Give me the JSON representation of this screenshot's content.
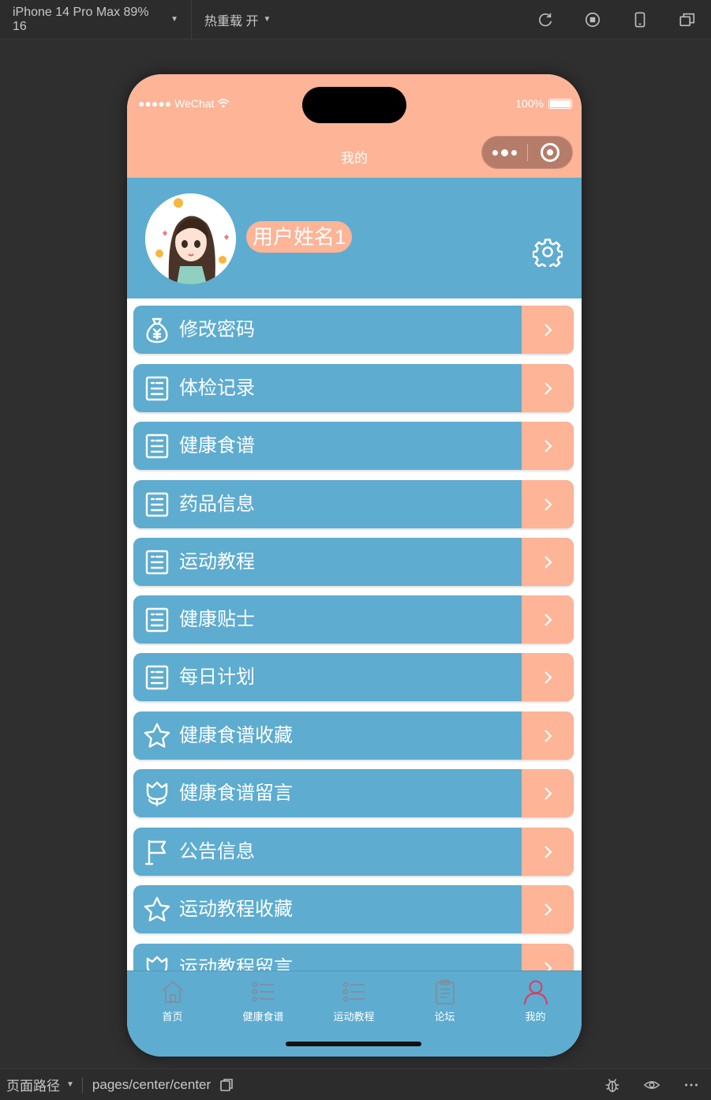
{
  "toolbar": {
    "device": "iPhone 14 Pro Max 89% 16",
    "hot_reload": "热重载 开",
    "icons": [
      "refresh-icon",
      "stop-icon",
      "phone-icon",
      "window-icon"
    ]
  },
  "statusbar": {
    "carrier": "●●●●● WeChat",
    "battery": "100%"
  },
  "nav": {
    "title": "我的"
  },
  "profile": {
    "username": "用户姓名1",
    "icons": [
      "avatar",
      "gear-icon"
    ]
  },
  "menu": [
    {
      "label": "修改密码",
      "icon": "money-bag-icon"
    },
    {
      "label": "体检记录",
      "icon": "document-icon"
    },
    {
      "label": "健康食谱",
      "icon": "document-icon"
    },
    {
      "label": "药品信息",
      "icon": "document-icon"
    },
    {
      "label": "运动教程",
      "icon": "document-icon"
    },
    {
      "label": "健康贴士",
      "icon": "document-icon"
    },
    {
      "label": "每日计划",
      "icon": "document-icon"
    },
    {
      "label": "健康食谱收藏",
      "icon": "star-icon"
    },
    {
      "label": "健康食谱留言",
      "icon": "tulip-icon"
    },
    {
      "label": "公告信息",
      "icon": "flag-icon"
    },
    {
      "label": "运动教程收藏",
      "icon": "star-icon"
    },
    {
      "label": "运动教程留言",
      "icon": "tulip-icon"
    }
  ],
  "tabbar": [
    {
      "label": "首页",
      "icon": "home-icon",
      "active": false
    },
    {
      "label": "健康食谱",
      "icon": "list-icon",
      "active": false
    },
    {
      "label": "运动教程",
      "icon": "list-icon",
      "active": false
    },
    {
      "label": "论坛",
      "icon": "clipboard-icon",
      "active": false
    },
    {
      "label": "我的",
      "icon": "user-icon",
      "active": true
    }
  ],
  "bottombar": {
    "path_label": "页面路径",
    "path": "pages/center/center",
    "icons": [
      "copy-icon",
      "bug-icon",
      "eye-icon",
      "more-icon"
    ]
  },
  "colors": {
    "primary": "#5eacd0",
    "accent": "#fdb497",
    "active_tab": "#e0395a"
  }
}
